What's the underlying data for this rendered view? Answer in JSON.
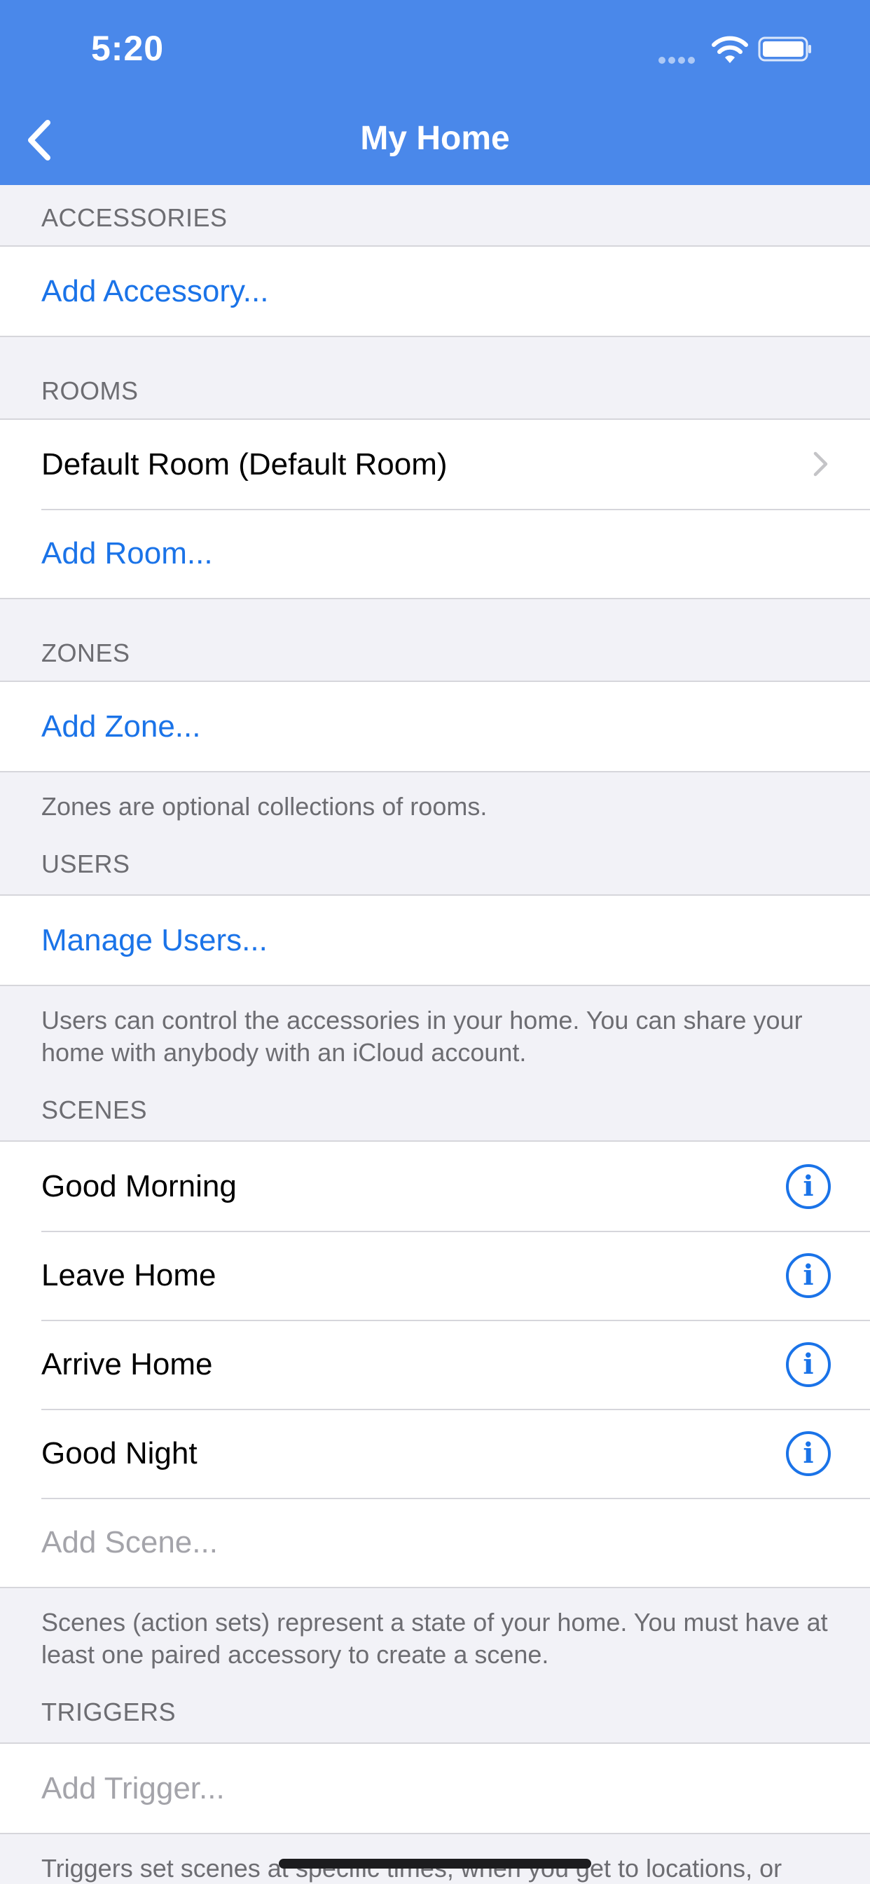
{
  "status_bar": {
    "time": "5:20"
  },
  "nav": {
    "title": "My Home",
    "back_icon": "chevron-left-icon"
  },
  "accessories": {
    "header": "ACCESSORIES",
    "add_label": "Add Accessory..."
  },
  "rooms": {
    "header": "ROOMS",
    "items": [
      "Default Room (Default Room)"
    ],
    "add_label": "Add Room..."
  },
  "zones": {
    "header": "ZONES",
    "add_label": "Add Zone...",
    "footer": "Zones are optional collections of rooms."
  },
  "users": {
    "header": "USERS",
    "manage_label": "Manage Users...",
    "footer": "Users can control the accessories in your home. You can share your home with anybody with an iCloud account."
  },
  "scenes": {
    "header": "SCENES",
    "items": [
      "Good Morning",
      "Leave Home",
      "Arrive Home",
      "Good Night"
    ],
    "info_icon_glyph": "i",
    "add_label": "Add Scene...",
    "footer": "Scenes (action sets) represent a state of your home. You must have at least one paired accessory to create a scene."
  },
  "triggers": {
    "header": "TRIGGERS",
    "add_label": "Add Trigger...",
    "footer": "Triggers set scenes at specific times, when you get to locations, or when a characteristic is in a specific state. You must have..."
  },
  "colors": {
    "nav_bar": "#4a88ea",
    "link": "#1a73e8",
    "disabled": "#a4a4aa",
    "background": "#f2f2f7"
  }
}
